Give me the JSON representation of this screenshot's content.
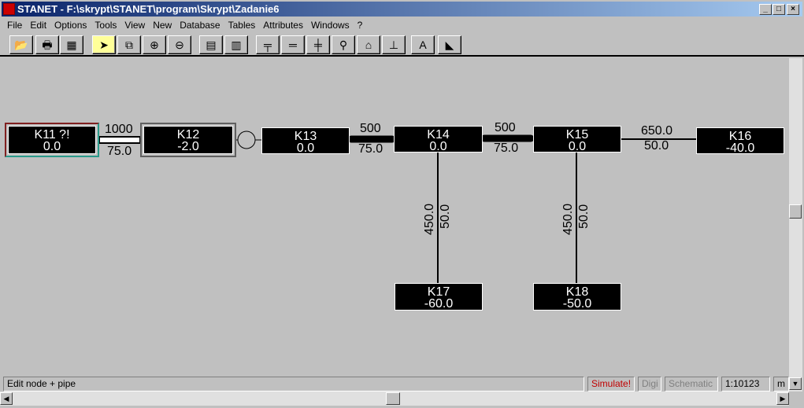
{
  "window": {
    "title": "STANET - F:\\skrypt\\STANET\\program\\Skrypt\\Zadanie6"
  },
  "menu": [
    "File",
    "Edit",
    "Options",
    "Tools",
    "View",
    "New",
    "Database",
    "Tables",
    "Attributes",
    "Windows",
    "?"
  ],
  "toolbar": [
    {
      "icon": "open-folder-icon",
      "glyph": "📂"
    },
    {
      "icon": "printer-icon",
      "glyph": "🖶"
    },
    {
      "icon": "calculator-icon",
      "glyph": "▦"
    },
    {
      "icon": "select-arrow-icon",
      "glyph": "➤",
      "active": true
    },
    {
      "icon": "schematic-icon",
      "glyph": "⧉"
    },
    {
      "icon": "zoom-in-icon",
      "glyph": "⊕"
    },
    {
      "icon": "zoom-out-icon",
      "glyph": "⊖"
    },
    {
      "icon": "table-icon",
      "glyph": "▤"
    },
    {
      "icon": "form-icon",
      "glyph": "▥"
    },
    {
      "icon": "pipe-valve-icon",
      "glyph": "╤"
    },
    {
      "icon": "pipe-icon",
      "glyph": "═"
    },
    {
      "icon": "valve-icon",
      "glyph": "╪"
    },
    {
      "icon": "tap-icon",
      "glyph": "⚲"
    },
    {
      "icon": "house-icon",
      "glyph": "⌂"
    },
    {
      "icon": "pump-station-icon",
      "glyph": "⊥"
    },
    {
      "icon": "text-icon",
      "glyph": "A"
    },
    {
      "icon": "shape-icon",
      "glyph": "◣"
    }
  ],
  "nodes": [
    {
      "name": "K11 ?!",
      "value": "0.0"
    },
    {
      "name": "K12",
      "value": "-2.0"
    },
    {
      "name": "K13",
      "value": "0.0"
    },
    {
      "name": "K14",
      "value": "0.0"
    },
    {
      "name": "K15",
      "value": "0.0"
    },
    {
      "name": "K16",
      "value": "-40.0"
    },
    {
      "name": "K17",
      "value": "-60.0"
    },
    {
      "name": "K18",
      "value": "-50.0"
    }
  ],
  "pipes": [
    {
      "from": "K11",
      "to": "K12",
      "length": "1000",
      "diameter": "75.0"
    },
    {
      "from": "K13",
      "to": "K14",
      "length": "500",
      "diameter": "75.0"
    },
    {
      "from": "K14",
      "to": "K15",
      "length": "500",
      "diameter": "75.0"
    },
    {
      "from": "K15",
      "to": "K16",
      "length": "650.0",
      "diameter": "50.0"
    },
    {
      "from": "K14",
      "to": "K17",
      "length": "450.0",
      "diameter": "50.0"
    },
    {
      "from": "K15",
      "to": "K18",
      "length": "450.0",
      "diameter": "50.0"
    }
  ],
  "status": {
    "mode": "Edit node + pipe",
    "simulate": "Simulate!",
    "digi": "Digi",
    "schematic": "Schematic",
    "scale": "1:10123",
    "unit": "m"
  },
  "colors": {
    "simulate": "#c00000",
    "titlebar": "#0a246a"
  }
}
